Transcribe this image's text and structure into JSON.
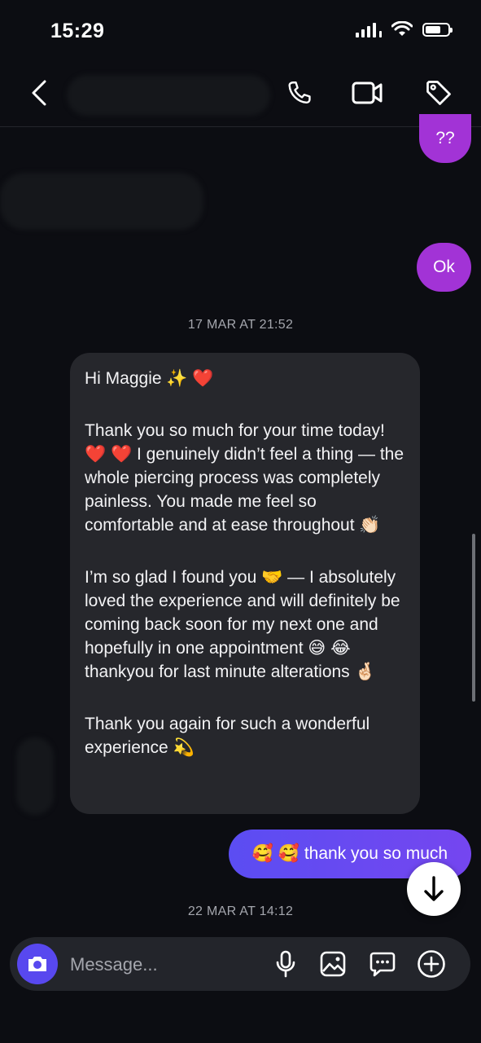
{
  "status_bar": {
    "time": "15:29",
    "battery_level": 0.7
  },
  "header": {
    "back_icon": "chevron-left-icon",
    "call_icon": "phone-icon",
    "video_icon": "video-camera-icon",
    "tag_icon": "tag-icon"
  },
  "messages": {
    "outgoing_1": "??",
    "outgoing_2": "Ok",
    "timestamp_1": "17 MAR AT 21:52",
    "incoming_paragraphs": [
      "Hi Maggie ✨ ❤️",
      "Thank you so much for your time today! ❤️ ❤️ I genuinely didn’t feel a thing — the whole piercing process was completely painless. You made me feel so comfortable and at ease throughout 👏🏻",
      "I’m so glad I found you 🤝 — I absolutely loved the experience and will definitely be coming back soon for my next one and hopefully in one appointment 😅 😂 thankyou for last minute alterations 🤞🏻",
      "Thank you again for such a wonderful experience 💫"
    ],
    "reply": "🥰 🥰 thank you so much",
    "timestamp_2": "22 MAR AT 14:12"
  },
  "composer": {
    "placeholder": "Message...",
    "icons": [
      "camera-icon",
      "microphone-icon",
      "gallery-icon",
      "sticker-icon",
      "plus-icon"
    ]
  },
  "colors": {
    "background": "#0c0d12",
    "outgoing_bubble": "#a233d6",
    "incoming_bubble": "#26272c",
    "reply_gradient_start": "#5b4df2",
    "accent": "#5848ef"
  }
}
